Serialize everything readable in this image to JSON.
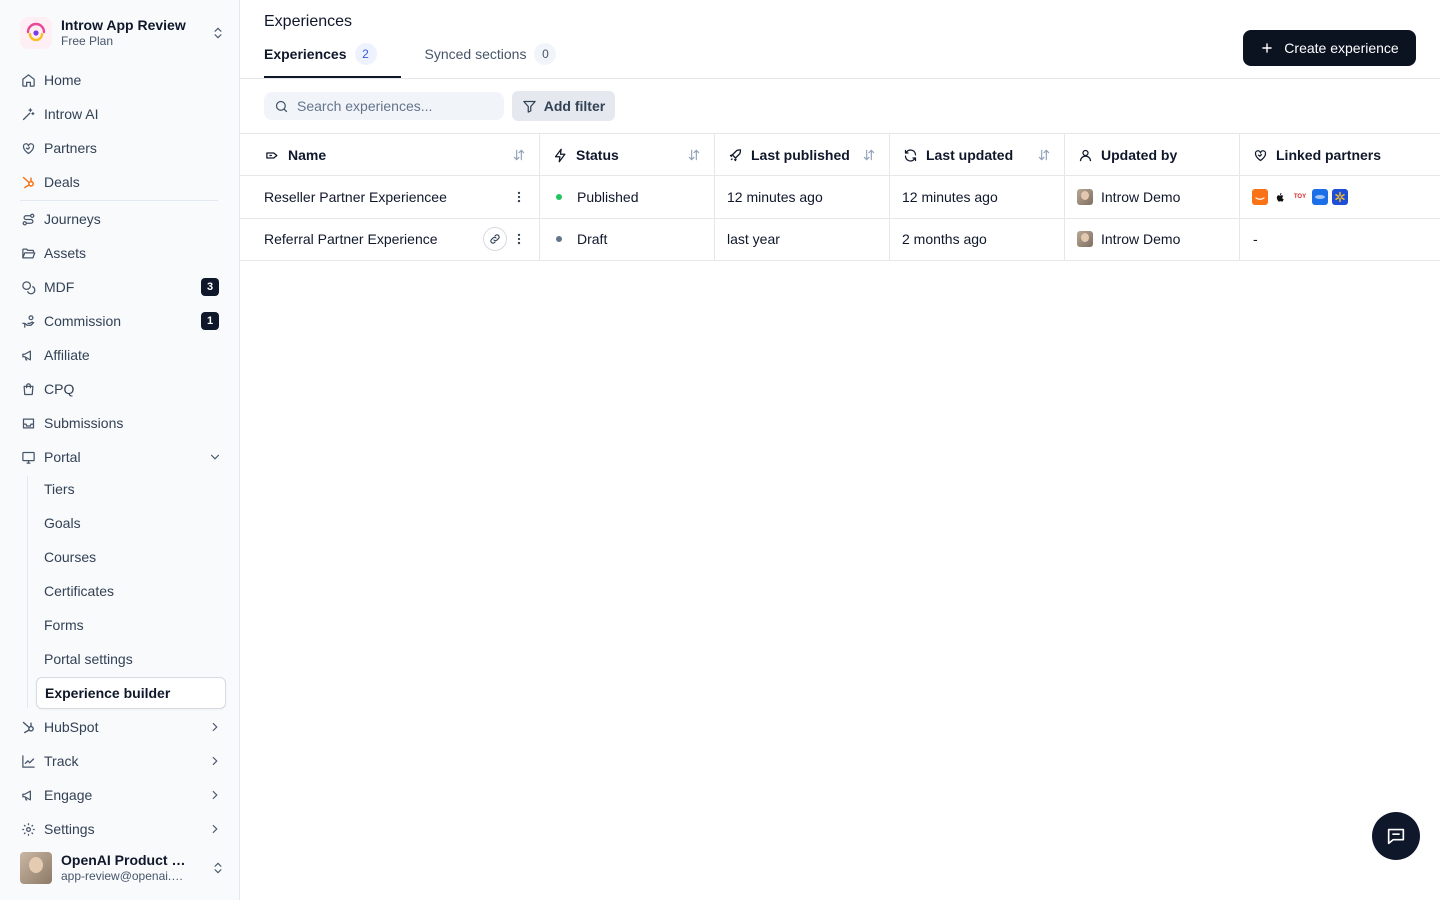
{
  "workspace": {
    "name": "Introw App Review",
    "plan": "Free Plan"
  },
  "sidebar": {
    "items": [
      {
        "key": "home",
        "label": "Home"
      },
      {
        "key": "introw-ai",
        "label": "Introw AI"
      },
      {
        "key": "partners",
        "label": "Partners"
      },
      {
        "key": "deals",
        "label": "Deals"
      },
      {
        "key": "journeys",
        "label": "Journeys"
      },
      {
        "key": "assets",
        "label": "Assets"
      },
      {
        "key": "mdf",
        "label": "MDF",
        "badge": "3"
      },
      {
        "key": "commission",
        "label": "Commission",
        "badge": "1"
      },
      {
        "key": "affiliate",
        "label": "Affiliate"
      },
      {
        "key": "cpq",
        "label": "CPQ"
      },
      {
        "key": "submissions",
        "label": "Submissions"
      },
      {
        "key": "portal",
        "label": "Portal"
      }
    ],
    "portal_sub": [
      {
        "label": "Tiers"
      },
      {
        "label": "Goals"
      },
      {
        "label": "Courses"
      },
      {
        "label": "Certificates"
      },
      {
        "label": "Forms"
      },
      {
        "label": "Portal settings"
      },
      {
        "label": "Experience builder"
      }
    ],
    "groups": [
      {
        "label": "HubSpot"
      },
      {
        "label": "Track"
      },
      {
        "label": "Engage"
      },
      {
        "label": "Settings"
      }
    ]
  },
  "user": {
    "name": "OpenAI Product Review",
    "email": "app-review@openai.com"
  },
  "page": {
    "title": "Experiences",
    "tabs": [
      {
        "label": "Experiences",
        "count": "2"
      },
      {
        "label": "Synced sections",
        "count": "0"
      }
    ],
    "create_label": "Create experience"
  },
  "toolbar": {
    "search_placeholder": "Search experiences...",
    "filter_label": "Add filter"
  },
  "table": {
    "columns": [
      "Name",
      "Status",
      "Last published",
      "Last updated",
      "Updated by",
      "Linked partners"
    ],
    "rows": [
      {
        "name": "Reseller Partner Experiencee",
        "status": "Published",
        "last_published": "12 minutes ago",
        "last_updated": "12 minutes ago",
        "updated_by": "Introw Demo",
        "linked": ""
      },
      {
        "name": "Referral Partner Experience",
        "status": "Draft",
        "last_published": "last year",
        "last_updated": "2 months ago",
        "updated_by": "Introw Demo",
        "linked": "-"
      }
    ]
  },
  "partner_logos": [
    "amazon",
    "apple",
    "toys-r-us",
    "samsung",
    "walmart"
  ],
  "colors": {
    "published": "#22c55e",
    "draft": "#64748b",
    "primary": "#0b1220",
    "deals_icon": "#f97316"
  }
}
